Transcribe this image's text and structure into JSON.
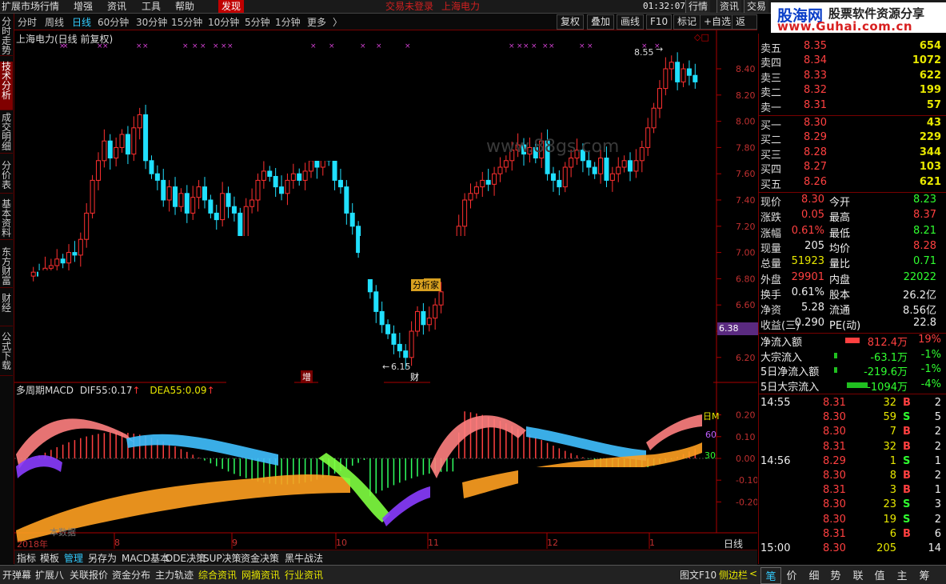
{
  "menu": {
    "items": [
      "扩展市场行情",
      "增强",
      "资讯",
      "工具",
      "帮助",
      "发现"
    ],
    "login_status": "交易未登录",
    "login_stock": "上海电力",
    "clock": "01:32:07 周三",
    "right_items": [
      "行情",
      "资讯",
      "交易"
    ]
  },
  "logo": {
    "brand": "股海网",
    "slogan": "股票软件资源分享",
    "url": "www.Guhai.com.cn"
  },
  "periods": [
    "分时",
    "周线",
    "日线",
    "60分钟",
    "30分钟",
    "15分钟",
    "10分钟",
    "5分钟",
    "1分钟",
    "更多"
  ],
  "period_active": "日线",
  "period_more_arrow": "〉",
  "tools": [
    "复权",
    "叠加",
    "画线",
    "F10",
    "标记",
    "+自选",
    "返回"
  ],
  "side_tabs": [
    "分时走势",
    "技术分析",
    "成交明细",
    "分价表",
    "基本资料",
    "东方财富",
    "财经",
    "公式下载"
  ],
  "side_active": "技术分析",
  "stock_title": "上海电力(日线 前复权)",
  "macd": {
    "name": "多周期MACD",
    "dif_label": "DIF55:",
    "dif_value": "0.17",
    "dea_label": "DEA55:",
    "dea_value": "0.09",
    "up_arrow": "↑"
  },
  "annotations": {
    "high_label": "8.55",
    "low_label": "6.15",
    "analyst": "分析家",
    "increase": "增",
    "finance": "财",
    "price_tag": "6.38",
    "watermark": "www.88gs.com",
    "legend_tag": "日M",
    "tag_60": "60",
    "tag_30": "30",
    "data_source": "本数据",
    "high_arrow": "→",
    "low_arrow": "←",
    "corner_marks": "◇□"
  },
  "price_axis": [
    "8.40",
    "8.20",
    "8.00",
    "7.80",
    "7.60",
    "7.40",
    "7.20",
    "7.00",
    "6.80",
    "6.60",
    "6.40",
    "6.20"
  ],
  "macd_axis": [
    "0.20",
    "0.10",
    "0.00",
    "-0.10",
    "-0.20"
  ],
  "x_axis": {
    "year": "2018年",
    "months": [
      "8",
      "9",
      "10",
      "11",
      "12",
      "1"
    ]
  },
  "period_label": "日线",
  "zoom_controls": [
    "+",
    "-",
    "0"
  ],
  "quotes": {
    "sell": [
      {
        "label": "卖五",
        "price": "8.35",
        "vol": "654"
      },
      {
        "label": "卖四",
        "price": "8.34",
        "vol": "1072"
      },
      {
        "label": "卖三",
        "price": "8.33",
        "vol": "622"
      },
      {
        "label": "卖二",
        "price": "8.32",
        "vol": "199"
      },
      {
        "label": "卖一",
        "price": "8.31",
        "vol": "57"
      }
    ],
    "buy": [
      {
        "label": "买一",
        "price": "8.30",
        "vol": "43"
      },
      {
        "label": "买二",
        "price": "8.29",
        "vol": "229"
      },
      {
        "label": "买三",
        "price": "8.28",
        "vol": "344"
      },
      {
        "label": "买四",
        "price": "8.27",
        "vol": "103"
      },
      {
        "label": "买五",
        "price": "8.26",
        "vol": "621"
      }
    ]
  },
  "stats": [
    {
      "l1": "现价",
      "v1": "8.30",
      "c1": "red",
      "l2": "今开",
      "v2": "8.23",
      "c2": "green"
    },
    {
      "l1": "涨跌",
      "v1": "0.05",
      "c1": "red",
      "l2": "最高",
      "v2": "8.37",
      "c2": "red"
    },
    {
      "l1": "涨幅",
      "v1": "0.61%",
      "c1": "red",
      "l2": "最低",
      "v2": "8.21",
      "c2": "green"
    },
    {
      "l1": "现量",
      "v1": "205",
      "c1": "white",
      "l2": "均价",
      "v2": "8.28",
      "c2": "red"
    },
    {
      "l1": "总量",
      "v1": "51923",
      "c1": "yellow",
      "l2": "量比",
      "v2": "0.71",
      "c2": "green"
    },
    {
      "l1": "外盘",
      "v1": "29901",
      "c1": "red",
      "l2": "内盘",
      "v2": "22022",
      "c2": "green"
    },
    {
      "l1": "换手",
      "v1": "0.61%",
      "c1": "white",
      "l2": "股本",
      "v2": "26.2亿",
      "c2": "white"
    },
    {
      "l1": "净资",
      "v1": "5.28",
      "c1": "white",
      "l2": "流通",
      "v2": "8.56亿",
      "c2": "white"
    },
    {
      "l1": "收益(三)",
      "v1": "0.290",
      "c1": "white",
      "l2": "PE(动)",
      "v2": "22.8",
      "c2": "white"
    }
  ],
  "flows": [
    {
      "label": "净流入额",
      "value": "812.4万",
      "pct": "19%",
      "color": "red"
    },
    {
      "label": "大宗流入",
      "value": "-63.1万",
      "pct": "-1%",
      "color": "green"
    },
    {
      "label": "5日净流入额",
      "value": "-219.6万",
      "pct": "-1%",
      "color": "green"
    },
    {
      "label": "5日大宗流入",
      "value": "-1094万",
      "pct": "-4%",
      "color": "green"
    }
  ],
  "ticks": [
    {
      "time": "14:55",
      "price": "8.31",
      "vol": "32",
      "bs": "B",
      "n": "2"
    },
    {
      "time": "",
      "price": "8.30",
      "vol": "59",
      "bs": "S",
      "n": "5"
    },
    {
      "time": "",
      "price": "8.30",
      "vol": "7",
      "bs": "B",
      "n": "2"
    },
    {
      "time": "",
      "price": "8.31",
      "vol": "32",
      "bs": "B",
      "n": "2"
    },
    {
      "time": "14:56",
      "price": "8.29",
      "vol": "1",
      "bs": "S",
      "n": "1"
    },
    {
      "time": "",
      "price": "8.30",
      "vol": "8",
      "bs": "B",
      "n": "2"
    },
    {
      "time": "",
      "price": "8.31",
      "vol": "3",
      "bs": "B",
      "n": "1"
    },
    {
      "time": "",
      "price": "8.30",
      "vol": "23",
      "bs": "S",
      "n": "3"
    },
    {
      "time": "",
      "price": "8.30",
      "vol": "19",
      "bs": "S",
      "n": "2"
    },
    {
      "time": "",
      "price": "8.31",
      "vol": "6",
      "bs": "B",
      "n": "6"
    },
    {
      "time": "15:00",
      "price": "8.30",
      "vol": "205",
      "bs": "",
      "n": "14"
    }
  ],
  "bottom_tabs": [
    "指标",
    "模板",
    "管理",
    "另存为",
    "MACD基本",
    "DDE决策",
    "SUP决策",
    "资金决策",
    "黑牛战法"
  ],
  "bottom_active": "管理",
  "status_items": [
    "开弹幕",
    "扩展八",
    "关联报价",
    "资金分布",
    "主力轨迹",
    "综合资讯",
    "网摘资讯",
    "行业资讯"
  ],
  "status_right": "图文F10",
  "status_right2": "侧边栏",
  "status_right2_arrow": "<",
  "right_tabs": [
    "笔",
    "价",
    "细",
    "势",
    "联",
    "值",
    "主",
    "筹"
  ],
  "right_tab_active": "笔"
}
